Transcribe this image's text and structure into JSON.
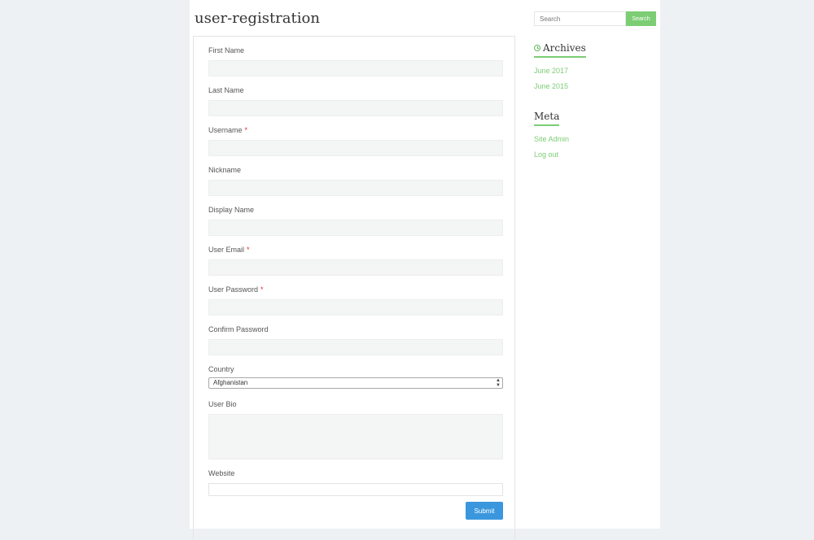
{
  "page": {
    "title": "user-registration"
  },
  "form": {
    "fields": [
      {
        "label": "First Name",
        "required": false,
        "value": ""
      },
      {
        "label": "Last Name",
        "required": false,
        "value": ""
      },
      {
        "label": "Username",
        "required": true,
        "value": ""
      },
      {
        "label": "Nickname",
        "required": false,
        "value": ""
      },
      {
        "label": "Display Name",
        "required": false,
        "value": ""
      },
      {
        "label": "User Email",
        "required": true,
        "value": ""
      },
      {
        "label": "User Password",
        "required": true,
        "value": ""
      },
      {
        "label": "Confirm Password",
        "required": false,
        "value": ""
      }
    ],
    "required_marker": "*",
    "country": {
      "label": "Country",
      "selected": "Afghanistan"
    },
    "bio": {
      "label": "User Bio",
      "value": ""
    },
    "website": {
      "label": "Website",
      "value": ""
    },
    "submit_label": "Submit"
  },
  "sidebar": {
    "search": {
      "placeholder": "Search",
      "button_label": "Search"
    },
    "archives": {
      "title": "Archives",
      "icon": "clock-icon",
      "items": [
        "June 2017",
        "June 2015"
      ]
    },
    "meta": {
      "title": "Meta",
      "items": [
        "Site Admin",
        "Log out"
      ]
    }
  },
  "colors": {
    "accent": "#7ccd74",
    "submit": "#3a97dd",
    "required": "#e02b2b",
    "background": "#eef1f3"
  }
}
